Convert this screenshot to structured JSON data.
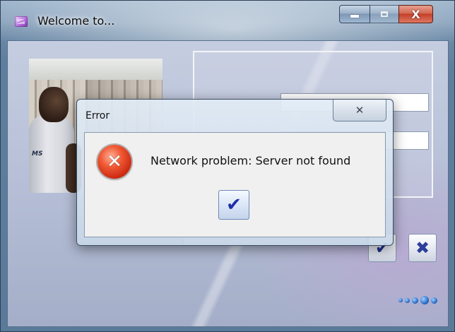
{
  "window": {
    "title": "Welcome to...",
    "caption": {
      "minimize_glyph": "▁",
      "maximize_glyph": "□",
      "close_glyph": "X"
    }
  },
  "login_form": {
    "login_value": "",
    "password_value": ""
  },
  "status_text": "",
  "buttons": {
    "ok_glyph": "✔",
    "cancel_glyph": "✖"
  },
  "loading_indicator": {
    "dot_count": 5,
    "active_index": 3
  },
  "error_dialog": {
    "title": "Error",
    "close_glyph": "✕",
    "icon": "error-icon",
    "icon_glyph": "✕",
    "message": "Network problem: Server not found",
    "ok_glyph": "✔"
  },
  "colors": {
    "error_red": "#e0401f",
    "check_blue": "#1f2fa8",
    "close_button_red": "#c4402a"
  }
}
